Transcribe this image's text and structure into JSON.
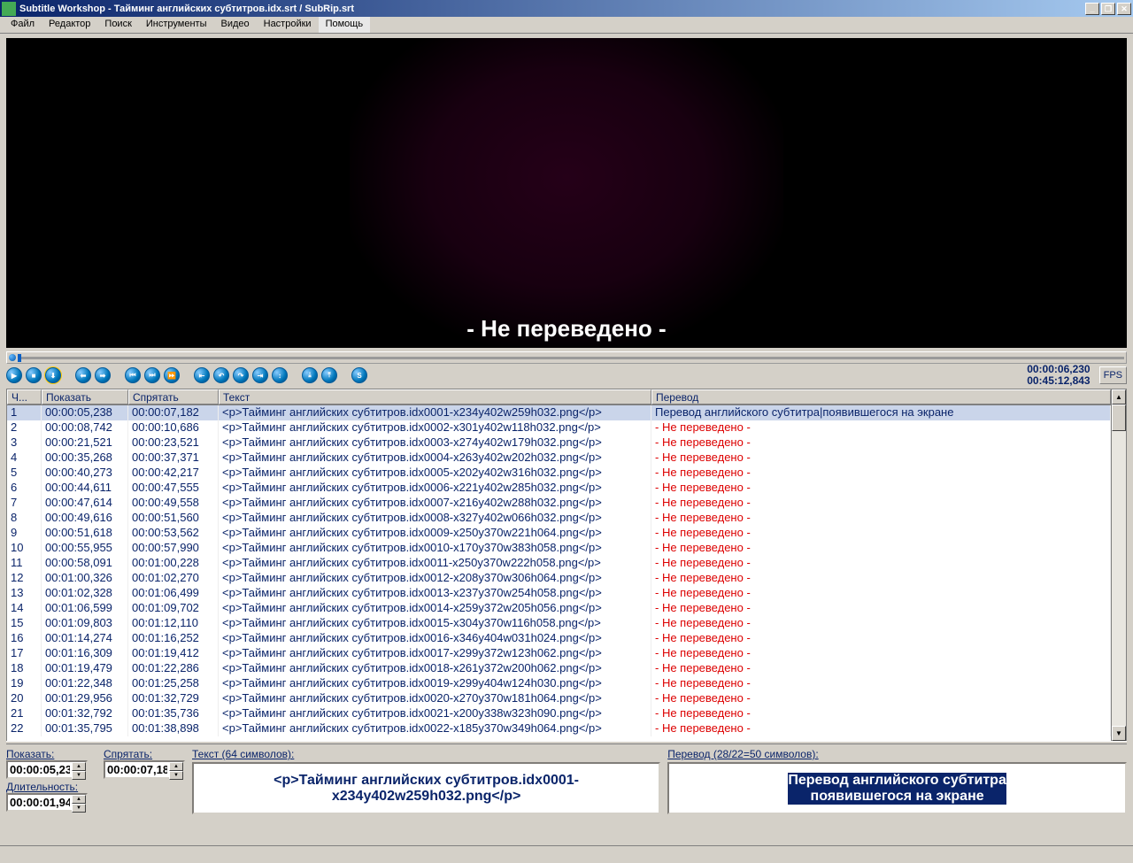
{
  "window": {
    "title": "Subtitle Workshop - Тайминг английских субтитров.idx.srt / SubRip.srt"
  },
  "menu": [
    "Файл",
    "Редактор",
    "Поиск",
    "Инструменты",
    "Видео",
    "Настройки",
    "Помощь"
  ],
  "video": {
    "subtitle": "- Не переведено -"
  },
  "time": {
    "current": "00:00:06,230",
    "total": "00:45:12,843",
    "fps": "FPS"
  },
  "grid": {
    "headers": {
      "num": "Ч...",
      "show": "Показать",
      "hide": "Спрятать",
      "text": "Текст",
      "tran": "Перевод"
    },
    "rows": [
      {
        "n": 1,
        "show": "00:00:05,238",
        "hide": "00:00:07,182",
        "text": "<p>Тайминг английских субтитров.idx0001-x234y402w259h032.png</p>",
        "tran": "Перевод английского субтитра|появившегося на экране",
        "sel": true,
        "red": false
      },
      {
        "n": 2,
        "show": "00:00:08,742",
        "hide": "00:00:10,686",
        "text": "<p>Тайминг английских субтитров.idx0002-x301y402w118h032.png</p>",
        "tran": "- Не переведено -",
        "red": true
      },
      {
        "n": 3,
        "show": "00:00:21,521",
        "hide": "00:00:23,521",
        "text": "<p>Тайминг английских субтитров.idx0003-x274y402w179h032.png</p>",
        "tran": "- Не переведено -",
        "red": true
      },
      {
        "n": 4,
        "show": "00:00:35,268",
        "hide": "00:00:37,371",
        "text": "<p>Тайминг английских субтитров.idx0004-x263y402w202h032.png</p>",
        "tran": "- Не переведено -",
        "red": true
      },
      {
        "n": 5,
        "show": "00:00:40,273",
        "hide": "00:00:42,217",
        "text": "<p>Тайминг английских субтитров.idx0005-x202y402w316h032.png</p>",
        "tran": "- Не переведено -",
        "red": true
      },
      {
        "n": 6,
        "show": "00:00:44,611",
        "hide": "00:00:47,555",
        "text": "<p>Тайминг английских субтитров.idx0006-x221y402w285h032.png</p>",
        "tran": "- Не переведено -",
        "red": true
      },
      {
        "n": 7,
        "show": "00:00:47,614",
        "hide": "00:00:49,558",
        "text": "<p>Тайминг английских субтитров.idx0007-x216y402w288h032.png</p>",
        "tran": "- Не переведено -",
        "red": true
      },
      {
        "n": 8,
        "show": "00:00:49,616",
        "hide": "00:00:51,560",
        "text": "<p>Тайминг английских субтитров.idx0008-x327y402w066h032.png</p>",
        "tran": "- Не переведено -",
        "red": true
      },
      {
        "n": 9,
        "show": "00:00:51,618",
        "hide": "00:00:53,562",
        "text": "<p>Тайминг английских субтитров.idx0009-x250y370w221h064.png</p>",
        "tran": "- Не переведено -",
        "red": true
      },
      {
        "n": 10,
        "show": "00:00:55,955",
        "hide": "00:00:57,990",
        "text": "<p>Тайминг английских субтитров.idx0010-x170y370w383h058.png</p>",
        "tran": "- Не переведено -",
        "red": true
      },
      {
        "n": 11,
        "show": "00:00:58,091",
        "hide": "00:01:00,228",
        "text": "<p>Тайминг английских субтитров.idx0011-x250y370w222h058.png</p>",
        "tran": "- Не переведено -",
        "red": true
      },
      {
        "n": 12,
        "show": "00:01:00,326",
        "hide": "00:01:02,270",
        "text": "<p>Тайминг английских субтитров.idx0012-x208y370w306h064.png</p>",
        "tran": "- Не переведено -",
        "red": true
      },
      {
        "n": 13,
        "show": "00:01:02,328",
        "hide": "00:01:06,499",
        "text": "<p>Тайминг английских субтитров.idx0013-x237y370w254h058.png</p>",
        "tran": "- Не переведено -",
        "red": true
      },
      {
        "n": 14,
        "show": "00:01:06,599",
        "hide": "00:01:09,702",
        "text": "<p>Тайминг английских субтитров.idx0014-x259y372w205h056.png</p>",
        "tran": "- Не переведено -",
        "red": true
      },
      {
        "n": 15,
        "show": "00:01:09,803",
        "hide": "00:01:12,110",
        "text": "<p>Тайминг английских субтитров.idx0015-x304y370w116h058.png</p>",
        "tran": "- Не переведено -",
        "red": true
      },
      {
        "n": 16,
        "show": "00:01:14,274",
        "hide": "00:01:16,252",
        "text": "<p>Тайминг английских субтитров.idx0016-x346y404w031h024.png</p>",
        "tran": "- Не переведено -",
        "red": true
      },
      {
        "n": 17,
        "show": "00:01:16,309",
        "hide": "00:01:19,412",
        "text": "<p>Тайминг английских субтитров.idx0017-x299y372w123h062.png</p>",
        "tran": "- Не переведено -",
        "red": true
      },
      {
        "n": 18,
        "show": "00:01:19,479",
        "hide": "00:01:22,286",
        "text": "<p>Тайминг английских субтитров.idx0018-x261y372w200h062.png</p>",
        "tran": "- Не переведено -",
        "red": true
      },
      {
        "n": 19,
        "show": "00:01:22,348",
        "hide": "00:01:25,258",
        "text": "<p>Тайминг английских субтитров.idx0019-x299y404w124h030.png</p>",
        "tran": "- Не переведено -",
        "red": true
      },
      {
        "n": 20,
        "show": "00:01:29,956",
        "hide": "00:01:32,729",
        "text": "<p>Тайминг английских субтитров.idx0020-x270y370w181h064.png</p>",
        "tran": "- Не переведено -",
        "red": true
      },
      {
        "n": 21,
        "show": "00:01:32,792",
        "hide": "00:01:35,736",
        "text": "<p>Тайминг английских субтитров.idx0021-x200y338w323h090.png</p>",
        "tran": "- Не переведено -",
        "red": true
      },
      {
        "n": 22,
        "show": "00:01:35,795",
        "hide": "00:01:38,898",
        "text": "<p>Тайминг английских субтитров.idx0022-x185y370w349h064.png</p>",
        "tran": "- Не переведено -",
        "red": true
      }
    ]
  },
  "editor": {
    "show_label": "Показать:",
    "hide_label": "Спрятать:",
    "dur_label": "Длительность:",
    "show": "00:00:05,23",
    "hide": "00:00:07,18",
    "dur": "00:00:01,94",
    "text_label": "Текст (64 символов):",
    "text": "<p>Тайминг английских субтитров.idx0001-x234y402w259h032.png</p>",
    "tran_label": "Перевод (28/22=50 символов):",
    "tran_line1": "Перевод английского субтитра",
    "tran_line2": "появившегося на экране"
  },
  "toolbar_icons": [
    "▶",
    "■",
    "⬇",
    "",
    "⬅",
    "➡",
    "",
    "⏮",
    "⏭",
    "⏩",
    "",
    "⇤",
    "↶",
    "↷",
    "⇥",
    "↕",
    "",
    "⤓",
    "⤒",
    "",
    "S"
  ]
}
